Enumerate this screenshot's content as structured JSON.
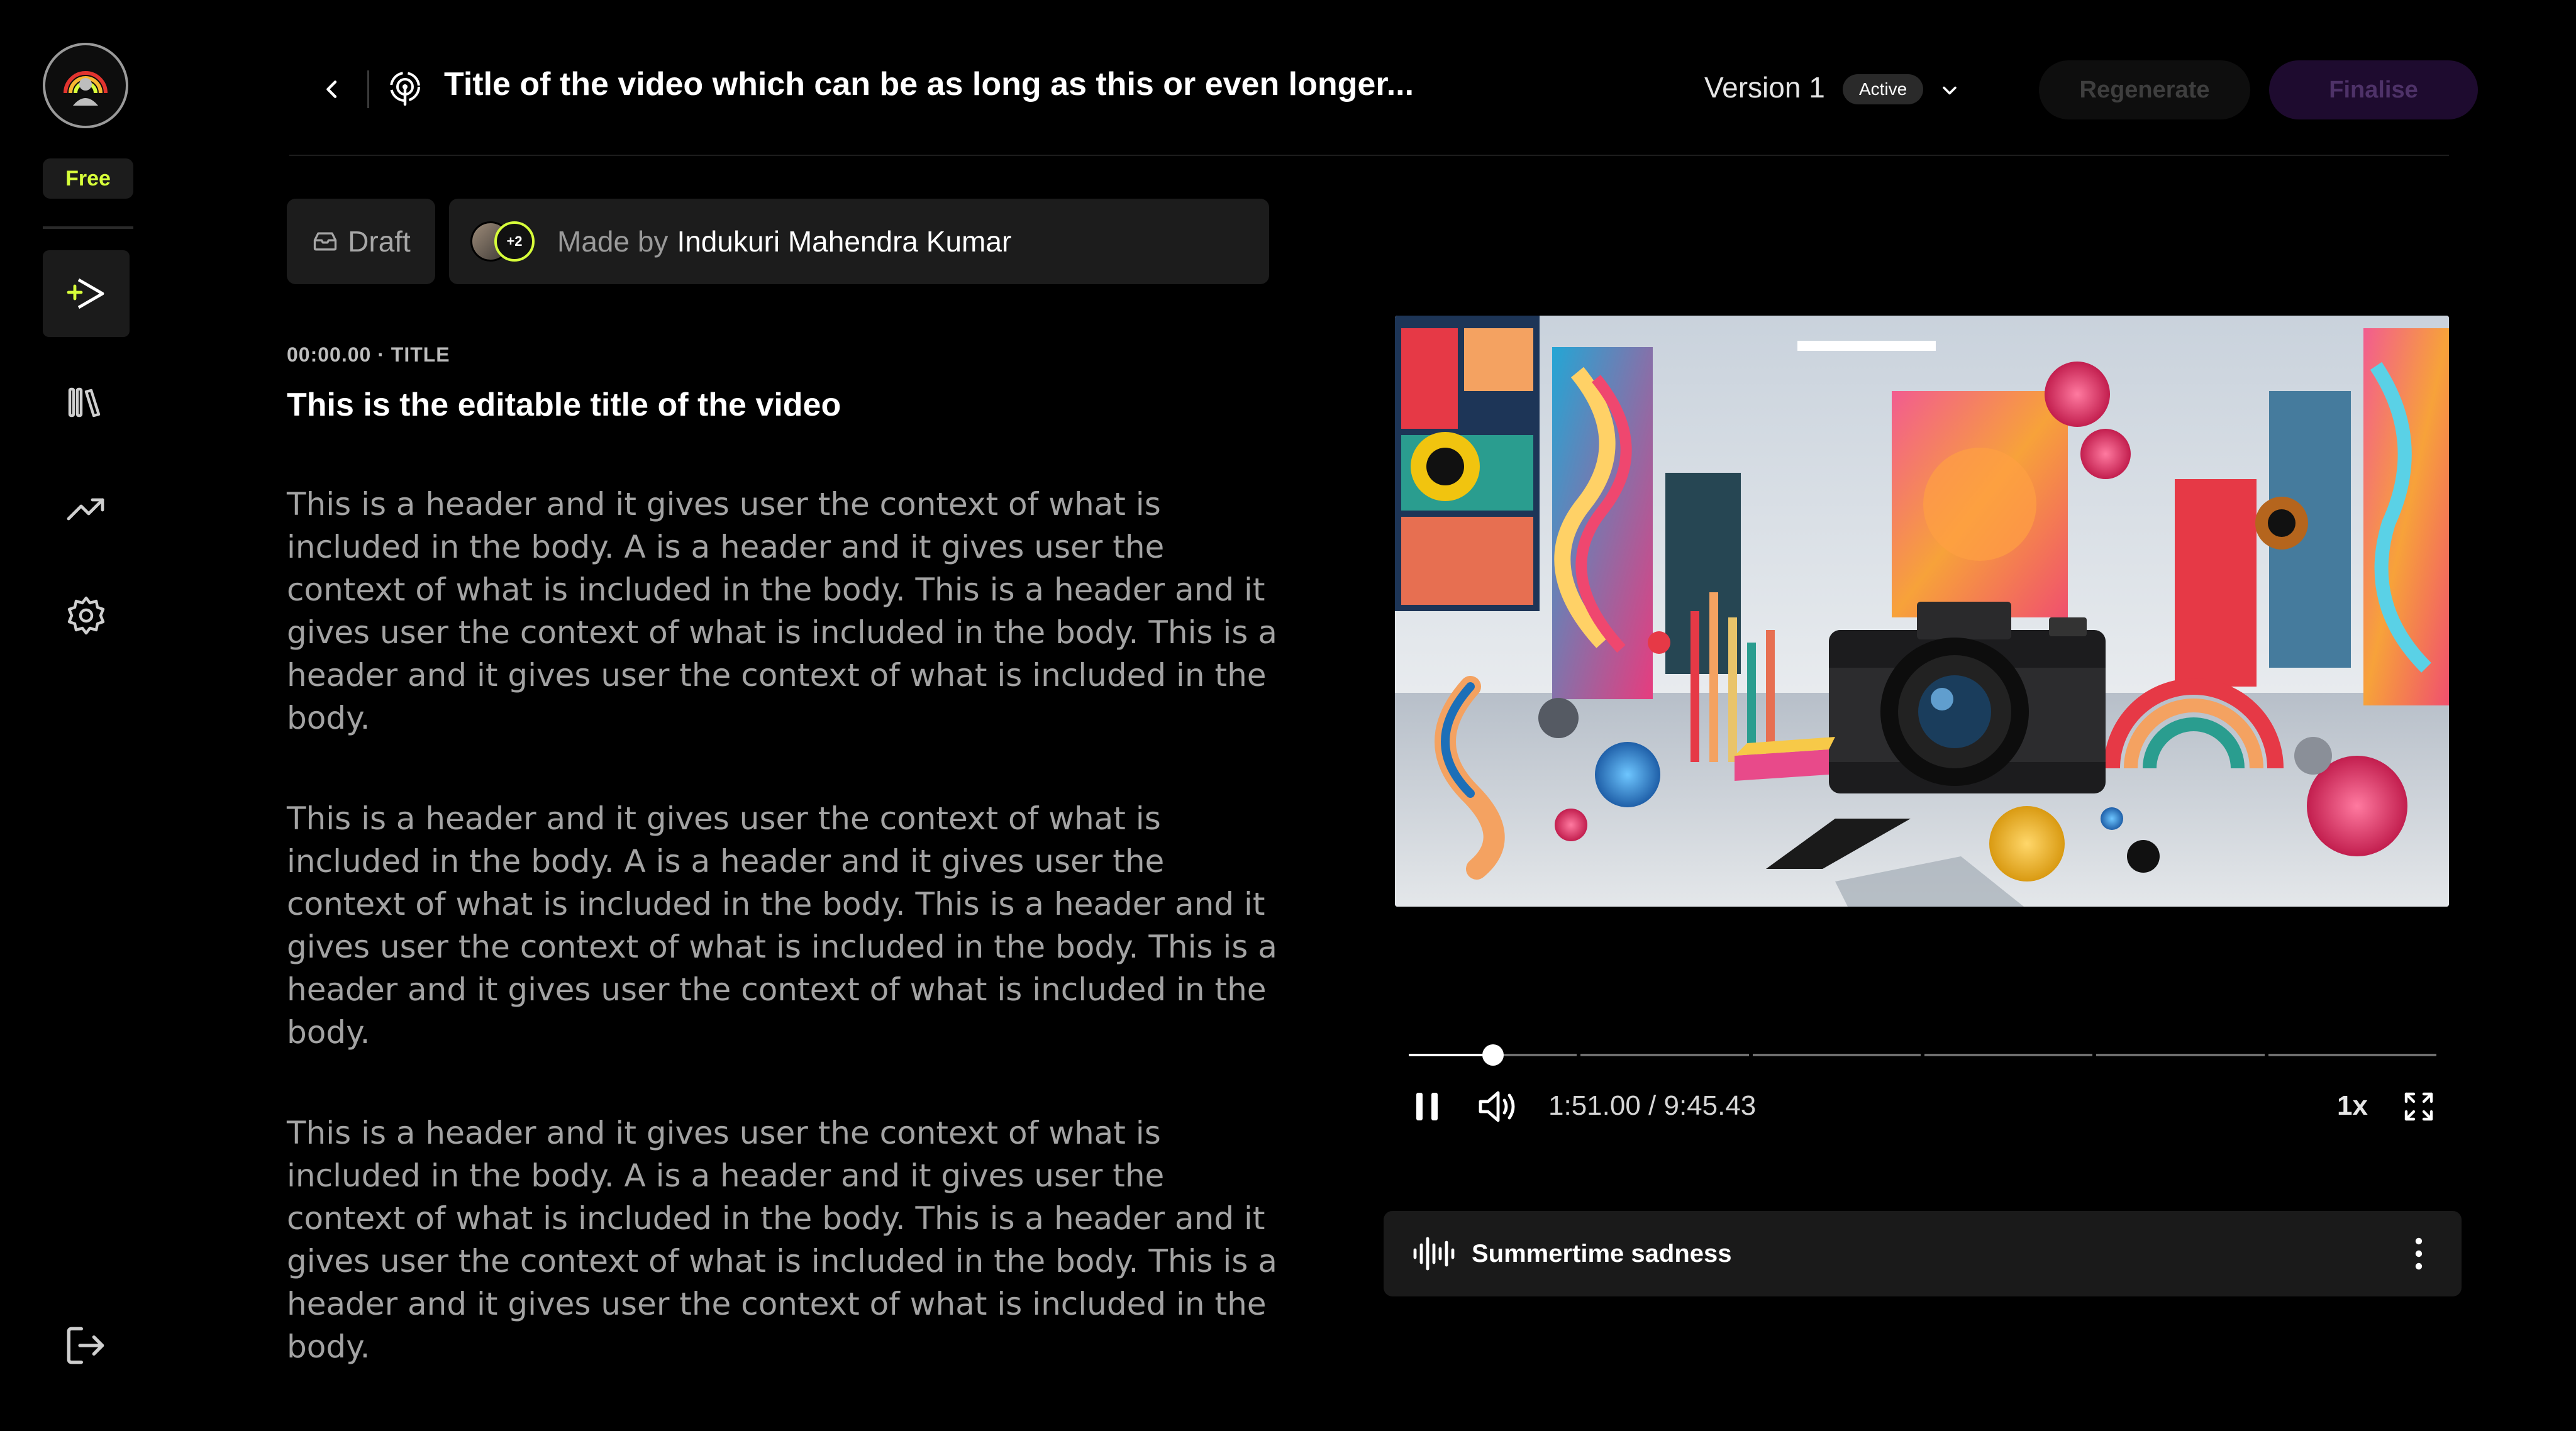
{
  "sidebar": {
    "plan_badge": "Free",
    "items": [
      {
        "name": "create",
        "icon": "play-plus-icon",
        "active": true
      },
      {
        "name": "library",
        "icon": "library-icon",
        "active": false
      },
      {
        "name": "analytics",
        "icon": "trending-up-icon",
        "active": false
      },
      {
        "name": "settings",
        "icon": "gear-icon",
        "active": false
      }
    ],
    "logout_icon": "logout-icon"
  },
  "header": {
    "title": "Title of the video which can be as long as this or even longer...",
    "version_label": "Version 1",
    "version_status": "Active",
    "regenerate_label": "Regenerate",
    "finalise_label": "Finalise"
  },
  "meta": {
    "status_label": "Draft",
    "made_by_prefix": "Made by",
    "author": "Indukuri Mahendra Kumar",
    "extra_collaborators": "+2"
  },
  "script": {
    "timestamp": "00:00.00 · TITLE",
    "title": "This is the editable title of the video",
    "paragraphs": [
      "This is a header and it gives user the context of what is included in the body. A is a header and it gives user the context of what is included in the body. This is a header and it gives user the context of what is included in the body. This is a header and it gives user the context of what is included in the body.",
      "This is a header and it gives user the context of what is included in the body. A is a header and it gives user the context of what is included in the body. This is a header and it gives user the context of what is included in the body. This is a header and it gives user the context of what is included in the body.",
      "This is a header and it gives user the context of what is included in the body. A is a header and it gives user the context of what is included in the body. This is a header and it gives user the context of what is included in the body. This is a header and it gives user the context of what is included in the body."
    ]
  },
  "player": {
    "time_readout": "1:51.00 / 9:45.43",
    "progress_fraction": 0.082,
    "segments": 6,
    "speed": "1x"
  },
  "music": {
    "track_name": "Summertime sadness"
  },
  "colors": {
    "accent_lime": "#d7ff3a",
    "finalise_bg": "#1e0b2f",
    "panel_bg": "#1c1c1c"
  }
}
